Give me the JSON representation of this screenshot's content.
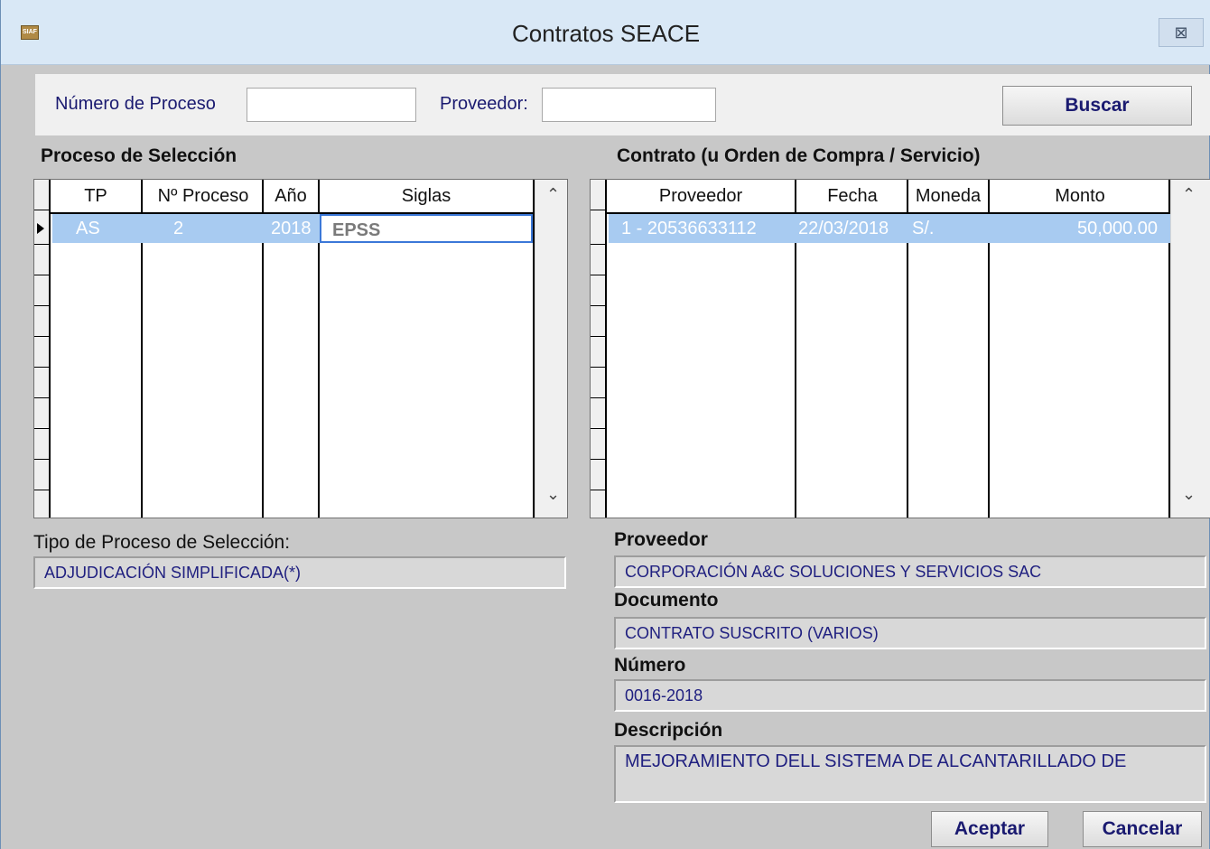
{
  "window": {
    "title": "Contratos SEACE",
    "icon": "siaf-app-icon",
    "close_glyph": "⊠"
  },
  "search": {
    "numero_label": "Número de Proceso",
    "numero_value": "",
    "proveedor_label": "Proveedor:",
    "proveedor_value": "",
    "buscar_label": "Buscar"
  },
  "left": {
    "section_title": "Proceso de Selección",
    "columns": [
      "TP",
      "Nº Proceso",
      "Año",
      "Siglas"
    ],
    "rows": [
      {
        "tp": "AS",
        "numero": "2",
        "anio": "2018",
        "siglas": "EPSS"
      }
    ],
    "tipo_label": "Tipo de Proceso de Selección:",
    "tipo_value": "ADJUDICACIÓN SIMPLIFICADA(*)"
  },
  "right": {
    "section_title": "Contrato (u Orden de Compra / Servicio)",
    "columns": [
      "Proveedor",
      "Fecha",
      "Moneda",
      "Monto"
    ],
    "rows": [
      {
        "proveedor": "1 - 20536633112",
        "fecha": "22/03/2018",
        "moneda": "S/.",
        "monto": "50,000.00"
      }
    ],
    "proveedor_label": "Proveedor",
    "proveedor_value": "CORPORACIÓN A&C SOLUCIONES Y SERVICIOS SAC",
    "documento_label": "Documento",
    "documento_value": "CONTRATO SUSCRITO (VARIOS)",
    "numero_label": "Número",
    "numero_value": "0016-2018",
    "descripcion_label": "Descripción",
    "descripcion_value": "MEJORAMIENTO DELL SISTEMA DE ALCANTARILLADO DE"
  },
  "actions": {
    "aceptar": "Aceptar",
    "cancelar": "Cancelar"
  },
  "colors": {
    "selection": "#a8cbf1",
    "field_text": "#202080",
    "label_blue": "#1a1a70"
  }
}
